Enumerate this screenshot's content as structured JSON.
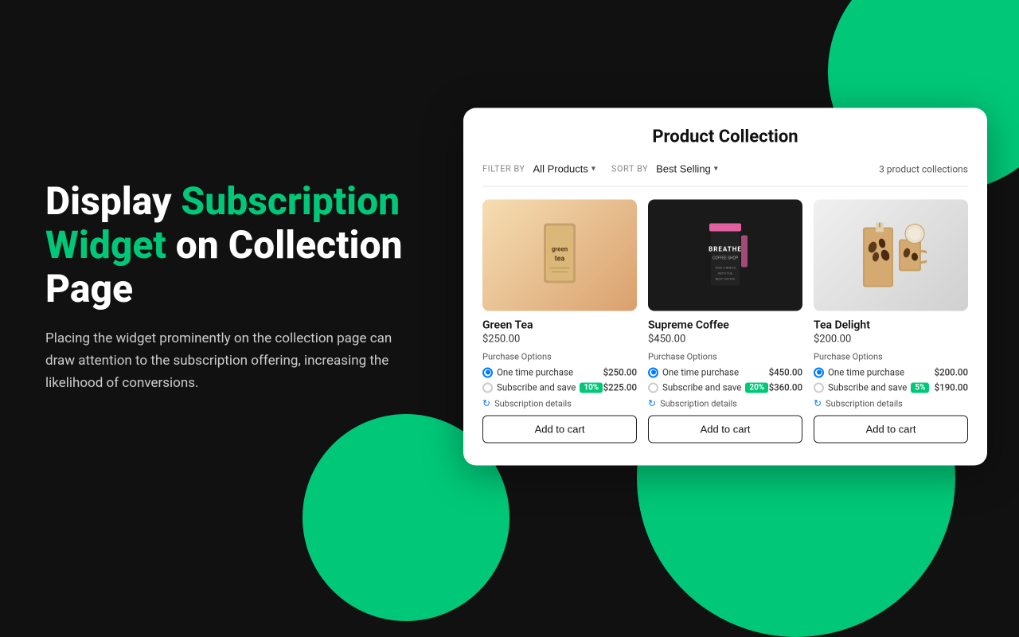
{
  "background": {
    "color": "#111111"
  },
  "hero": {
    "title_part1": "Display ",
    "title_accent": "Subscription Widget",
    "title_part2": " on Collection Page",
    "description": "Placing the widget prominently on the collection page can draw attention to the subscription offering, increasing the likelihood of conversions."
  },
  "panel": {
    "title": "Product Collection",
    "filter_label": "FILTER BY",
    "filter_value": "All Products",
    "sort_label": "SORT BY",
    "sort_value": "Best Selling",
    "collection_count": "3 product collections",
    "products": [
      {
        "id": "green-tea",
        "name": "Green Tea",
        "price": "$250.00",
        "image_bg": "green-bg",
        "image_label": "Green Tea Package",
        "purchase_options_label": "Purchase Options",
        "options": [
          {
            "type": "one_time",
            "label": "One time purchase",
            "price": "$250.00",
            "selected": true,
            "badge": null,
            "badge_text": null
          },
          {
            "type": "subscribe",
            "label": "Subscribe and save",
            "price": "$225.00",
            "selected": false,
            "badge": "10%",
            "badge_color": "#00c878"
          }
        ],
        "subscription_details_label": "Subscription details",
        "add_to_cart_label": "Add to cart"
      },
      {
        "id": "supreme-coffee",
        "name": "Supreme Coffee",
        "price": "$450.00",
        "image_bg": "pink-bg",
        "image_label": "Supreme Coffee Package",
        "purchase_options_label": "Purchase Options",
        "options": [
          {
            "type": "one_time",
            "label": "One time purchase",
            "price": "$450.00",
            "selected": true,
            "badge": null
          },
          {
            "type": "subscribe",
            "label": "Subscribe and save",
            "price": "$360.00",
            "selected": false,
            "badge": "20%",
            "badge_color": "#00c878"
          }
        ],
        "subscription_details_label": "Subscription details",
        "add_to_cart_label": "Add to cart"
      },
      {
        "id": "tea-delight",
        "name": "Tea Delight",
        "price": "$200.00",
        "image_bg": "gray-bg",
        "image_label": "Tea Delight Package",
        "purchase_options_label": "Purchase Options",
        "options": [
          {
            "type": "one_time",
            "label": "One time purchase",
            "price": "$200.00",
            "selected": true,
            "badge": null
          },
          {
            "type": "subscribe",
            "label": "Subscribe and save",
            "price": "$190.00",
            "selected": false,
            "badge": "5%",
            "badge_color": "#00c878"
          }
        ],
        "subscription_details_label": "Subscription details",
        "add_to_cart_label": "Add to cart"
      }
    ]
  },
  "colors": {
    "accent": "#00c878",
    "radio_selected": "#007bff",
    "background": "#111111"
  }
}
